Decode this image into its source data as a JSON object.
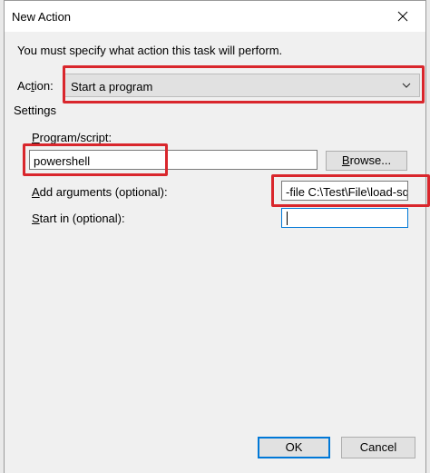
{
  "window": {
    "title": "New Action"
  },
  "prompt": "You must specify what action this task will perform.",
  "action": {
    "label_pre": "Ac",
    "label_u": "t",
    "label_post": "ion:",
    "selected": "Start a program"
  },
  "settings": {
    "label": "Settings",
    "program": {
      "label_u": "P",
      "label_post": "rogram/script:",
      "value": "powershell",
      "browse_u": "B",
      "browse_post": "rowse..."
    },
    "arguments": {
      "label_u": "A",
      "label_post": "dd arguments (optional):",
      "value": "-file C:\\Test\\File\\load-sqlc"
    },
    "start_in": {
      "label_u": "S",
      "label_post": "tart in (optional):",
      "value": ""
    }
  },
  "buttons": {
    "ok": "OK",
    "cancel": "Cancel"
  },
  "colors": {
    "highlight": "#d9262c",
    "focus": "#0078d7"
  }
}
